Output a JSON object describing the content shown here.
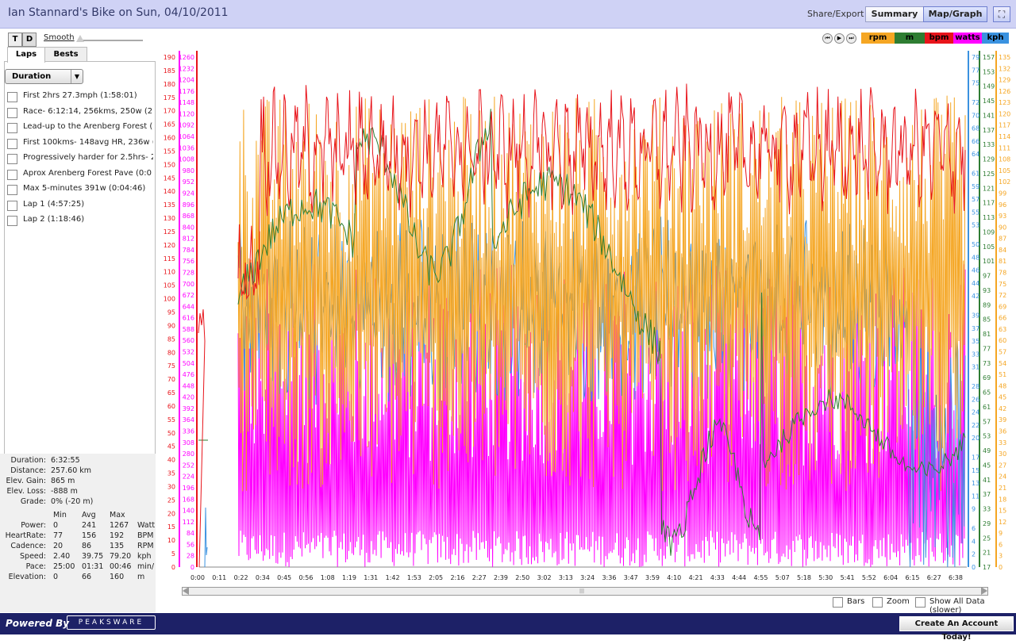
{
  "header": {
    "title": "Ian  Stannard's Bike on Sun, 04/10/2011",
    "share_export": "Share/Export",
    "summary_btn": "Summary",
    "mapgraph_btn": "Map/Graph"
  },
  "controls": {
    "t_label": "T",
    "d_label": "D",
    "smooth_label": "Smooth",
    "laps_tab": "Laps",
    "bests_tab": "Bests",
    "dropdown_value": "Duration"
  },
  "laps": [
    "First 2hrs 27.3mph (1:58:01)",
    "Race- 6:12:14, 256kms, 250w (2",
    "Lead-up to the Arenberg Forest (",
    "First 100kms- 148avg HR, 236w (",
    "Progressively harder for 2.5hrs- 2",
    "Aprox Arenberg Forest Pave (0:0",
    "Max 5-minutes 391w (0:04:46)",
    "Lap 1 (4:57:25)",
    "Lap 2 (1:18:46)"
  ],
  "summary": {
    "duration_label": "Duration:",
    "duration": "6:32:55",
    "distance_label": "Distance:",
    "distance": "257.60 km",
    "gain_label": "Elev. Gain:",
    "gain": "865 m",
    "loss_label": "Elev. Loss:",
    "loss": "-888 m",
    "grade_label": "Grade:",
    "grade": "0% (-20 m)",
    "col_min": "Min",
    "col_avg": "Avg",
    "col_max": "Max",
    "rows": [
      {
        "label": "Power:",
        "min": "0",
        "avg": "241",
        "max": "1267",
        "unit": "Watt"
      },
      {
        "label": "HeartRate:",
        "min": "77",
        "avg": "156",
        "max": "192",
        "unit": "BPM"
      },
      {
        "label": "Cadence:",
        "min": "20",
        "avg": "86",
        "max": "135",
        "unit": "RPM"
      },
      {
        "label": "Speed:",
        "min": "2.40",
        "avg": "39.75",
        "max": "79.20",
        "unit": "kph"
      },
      {
        "label": "Pace:",
        "min": "25:00",
        "avg": "01:31",
        "max": "00:46",
        "unit": "min/"
      },
      {
        "label": "Elevation:",
        "min": "0",
        "avg": "66",
        "max": "160",
        "unit": "m"
      }
    ]
  },
  "legend": {
    "rpm": "rpm",
    "m": "m",
    "bpm": "bpm",
    "watts": "watts",
    "kph": "kph"
  },
  "colors": {
    "rpm": "#f5a623",
    "m": "#2e7d32",
    "bpm": "#e8141b",
    "watts": "#ff00ff",
    "kph": "#3a92e0"
  },
  "options": {
    "bars": "Bars",
    "zoom": "Zoom",
    "show_all": "Show All Data (slower)"
  },
  "footer": {
    "powered_by": "Powered By",
    "logo": "PEAKSWARE",
    "create_account": "Create An Account Today!"
  },
  "chart_data": {
    "type": "line",
    "x_ticks": [
      "0:00",
      "0:11",
      "0:22",
      "0:34",
      "0:45",
      "0:56",
      "1:08",
      "1:19",
      "1:31",
      "1:42",
      "1:53",
      "2:05",
      "2:16",
      "2:27",
      "2:39",
      "2:50",
      "3:02",
      "3:13",
      "3:24",
      "3:36",
      "3:47",
      "3:59",
      "4:10",
      "4:21",
      "4:33",
      "4:44",
      "4:55",
      "5:07",
      "5:18",
      "5:30",
      "5:41",
      "5:52",
      "6:04",
      "6:15",
      "6:27",
      "6:38"
    ],
    "axes": {
      "bpm": {
        "min": 0,
        "max": 190,
        "ticks": [
          0,
          5,
          10,
          15,
          20,
          25,
          30,
          35,
          40,
          45,
          50,
          55,
          60,
          65,
          70,
          75,
          80,
          85,
          90,
          95,
          100,
          105,
          110,
          115,
          120,
          125,
          130,
          135,
          140,
          145,
          150,
          155,
          160,
          165,
          170,
          175,
          180,
          185,
          190
        ]
      },
      "watts": {
        "min": 0,
        "max": 1260,
        "ticks": [
          0,
          28,
          56,
          84,
          112,
          140,
          168,
          196,
          224,
          252,
          280,
          308,
          336,
          364,
          392,
          420,
          448,
          476,
          504,
          532,
          560,
          588,
          616,
          644,
          672,
          700,
          728,
          756,
          784,
          812,
          840,
          868,
          896,
          924,
          952,
          980,
          1008,
          1036,
          1064,
          1092,
          1120,
          1148,
          1176,
          1204,
          1232,
          1260
        ]
      },
      "kph": {
        "min": 0,
        "max": 79,
        "ticks": [
          0,
          2,
          4,
          6,
          9,
          11,
          13,
          15,
          17,
          20,
          22,
          24,
          26,
          28,
          31,
          33,
          35,
          37,
          39,
          42,
          44,
          46,
          48,
          50,
          53,
          55,
          57,
          59,
          61,
          64,
          66,
          68,
          70,
          72,
          75,
          77,
          79
        ]
      },
      "m": {
        "min": 17,
        "max": 157,
        "ticks": [
          17,
          21,
          25,
          29,
          33,
          37,
          41,
          45,
          49,
          53,
          57,
          61,
          65,
          69,
          73,
          77,
          81,
          85,
          89,
          93,
          97,
          101,
          105,
          109,
          113,
          117,
          121,
          125,
          129,
          133,
          137,
          141,
          145,
          149,
          153,
          157
        ]
      },
      "rpm": {
        "min": 0,
        "max": 135,
        "ticks": [
          0,
          3,
          6,
          9,
          12,
          15,
          18,
          21,
          24,
          27,
          30,
          33,
          36,
          39,
          42,
          45,
          48,
          51,
          54,
          57,
          60,
          63,
          66,
          69,
          72,
          75,
          78,
          81,
          84,
          87,
          90,
          93,
          96,
          99,
          102,
          105,
          108,
          111,
          114,
          117,
          120,
          123,
          126,
          129,
          132,
          135
        ]
      }
    },
    "series": [
      {
        "name": "watts",
        "pattern": "oscillating",
        "typical_low": 0,
        "typical_high": 600
      },
      {
        "name": "kph",
        "pattern": "oscillating",
        "typical_low": 30,
        "typical_high": 60
      },
      {
        "name": "rpm",
        "pattern": "oscillating",
        "typical_low": 30,
        "typical_high": 120
      },
      {
        "name": "bpm",
        "pattern": "oscillating",
        "typical_low": 130,
        "typical_high": 185
      },
      {
        "name": "m",
        "pattern": "elevation",
        "typical_low": 17,
        "typical_high": 157
      }
    ]
  }
}
